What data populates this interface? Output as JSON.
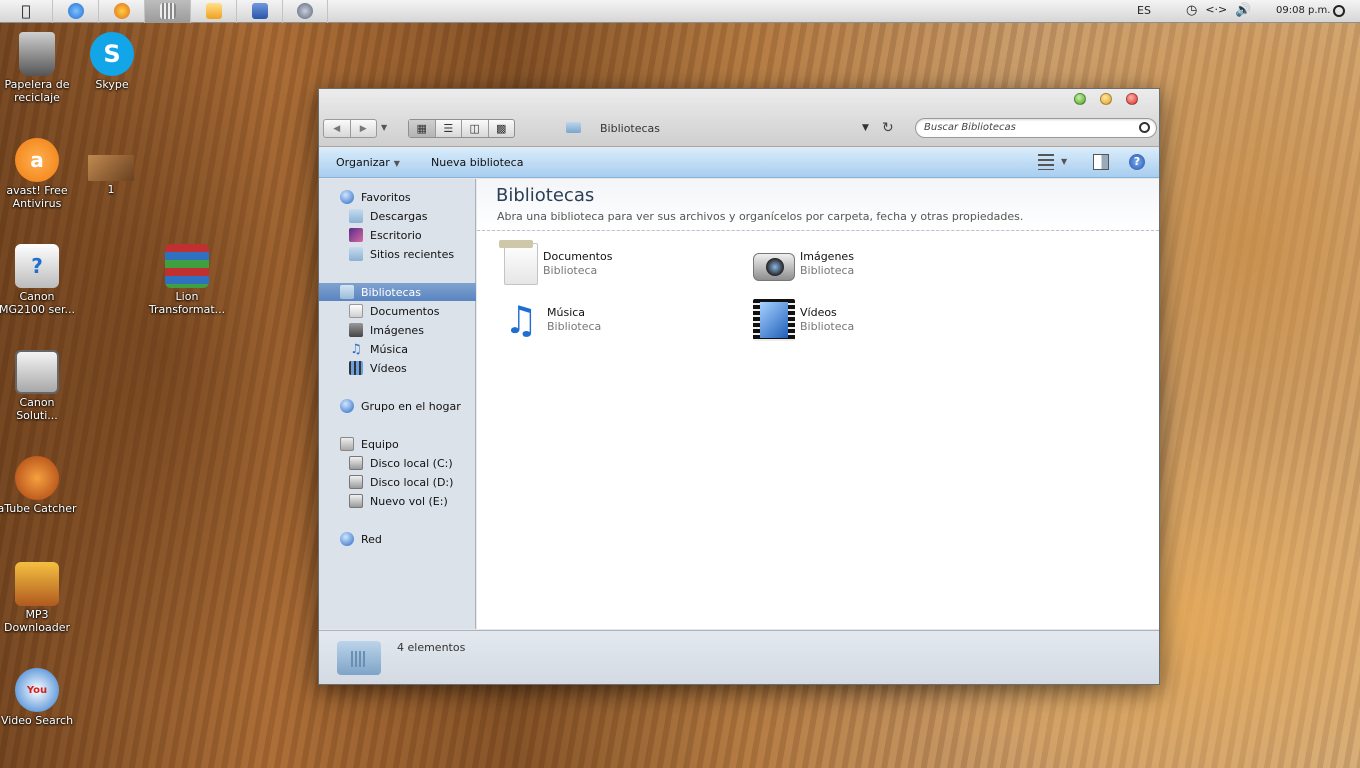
{
  "menubar": {
    "apple_icon": "apple-icon",
    "apps": [
      {
        "name": "internet-explorer",
        "color": "#1f6fd0"
      },
      {
        "name": "firefox",
        "color": "#e06a1a"
      },
      {
        "name": "libraries",
        "color": "#8a8a8a",
        "active": true
      },
      {
        "name": "media-player",
        "color": "#f0a020"
      },
      {
        "name": "word",
        "color": "#2a56a8"
      },
      {
        "name": "utility",
        "color": "#556677"
      }
    ],
    "language": "ES",
    "clock": "09:08 p.m."
  },
  "desktop": {
    "icons": [
      {
        "label": "Papelera de reciclaje",
        "color": "#666666"
      },
      {
        "label": "Skype",
        "color": "#12a5e8"
      },
      {
        "label": "avast! Free Antivirus",
        "color": "#f07c10"
      },
      {
        "label": "1",
        "color": "#a07040"
      },
      {
        "label": "Canon MG2100 ser...",
        "color": "#dddddd"
      },
      {
        "label": "Lion Transformat...",
        "color": "#c03030"
      },
      {
        "label": "Canon Soluti...",
        "color": "#cccccc"
      },
      {
        "label": "aTube Catcher",
        "color": "#e87020"
      },
      {
        "label": "MP3 Downloader",
        "color": "#d0702a"
      },
      {
        "label": "Video Search",
        "color": "#d22020"
      }
    ]
  },
  "window": {
    "address": "Bibliotecas",
    "search_placeholder": "Buscar Bibliotecas",
    "commands": {
      "organize": "Organizar",
      "new_library": "Nueva biblioteca"
    },
    "sidebar": {
      "favorites": "Favoritos",
      "favorites_items": [
        "Descargas",
        "Escritorio",
        "Sitios recientes"
      ],
      "libraries": "Bibliotecas",
      "libraries_items": [
        "Documentos",
        "Imágenes",
        "Música",
        "Vídeos"
      ],
      "homegroup": "Grupo en el hogar",
      "computer": "Equipo",
      "computer_items": [
        "Disco local (C:)",
        "Disco local (D:)",
        "Nuevo vol (E:)"
      ],
      "network": "Red"
    },
    "content": {
      "title": "Bibliotecas",
      "subtitle": "Abra una biblioteca para ver sus archivos y organícelos por carpeta, fecha y otras propiedades.",
      "libraries": [
        {
          "name": "Documentos",
          "kind": "Biblioteca"
        },
        {
          "name": "Imágenes",
          "kind": "Biblioteca"
        },
        {
          "name": "Música",
          "kind": "Biblioteca"
        },
        {
          "name": "Vídeos",
          "kind": "Biblioteca"
        }
      ]
    },
    "status": "4 elementos"
  }
}
